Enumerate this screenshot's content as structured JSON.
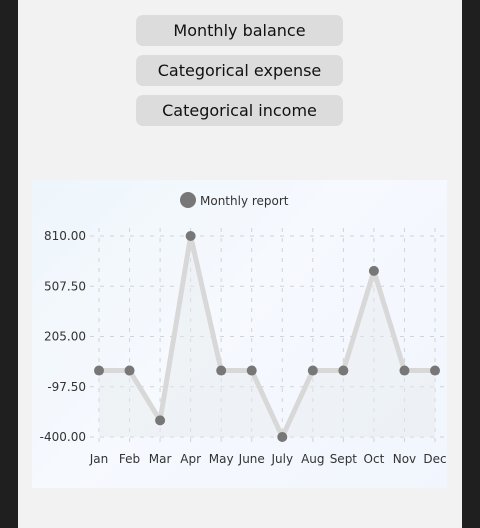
{
  "buttons": {
    "monthly_balance": "Monthly balance",
    "categorical_expense": "Categorical expense",
    "categorical_income": "Categorical income"
  },
  "chart_data": {
    "type": "line",
    "legend": "Monthly report",
    "categories": [
      "Jan",
      "Feb",
      "Mar",
      "Apr",
      "May",
      "June",
      "July",
      "Aug",
      "Sept",
      "Oct",
      "Nov",
      "Dec"
    ],
    "series": [
      {
        "name": "Monthly report",
        "values": [
          0,
          0,
          -300,
          810,
          0,
          0,
          -400,
          0,
          0,
          600,
          0,
          0
        ]
      }
    ],
    "y_ticks": [
      "810.00",
      "507.50",
      "205.00",
      "-97.50",
      "-400.00"
    ],
    "ylim": [
      -400,
      810
    ],
    "grid": true,
    "legend_position": "top-center",
    "colors": {
      "line": "#d8d8d8",
      "point": "#777777",
      "grid": "#cfd4d8"
    }
  }
}
